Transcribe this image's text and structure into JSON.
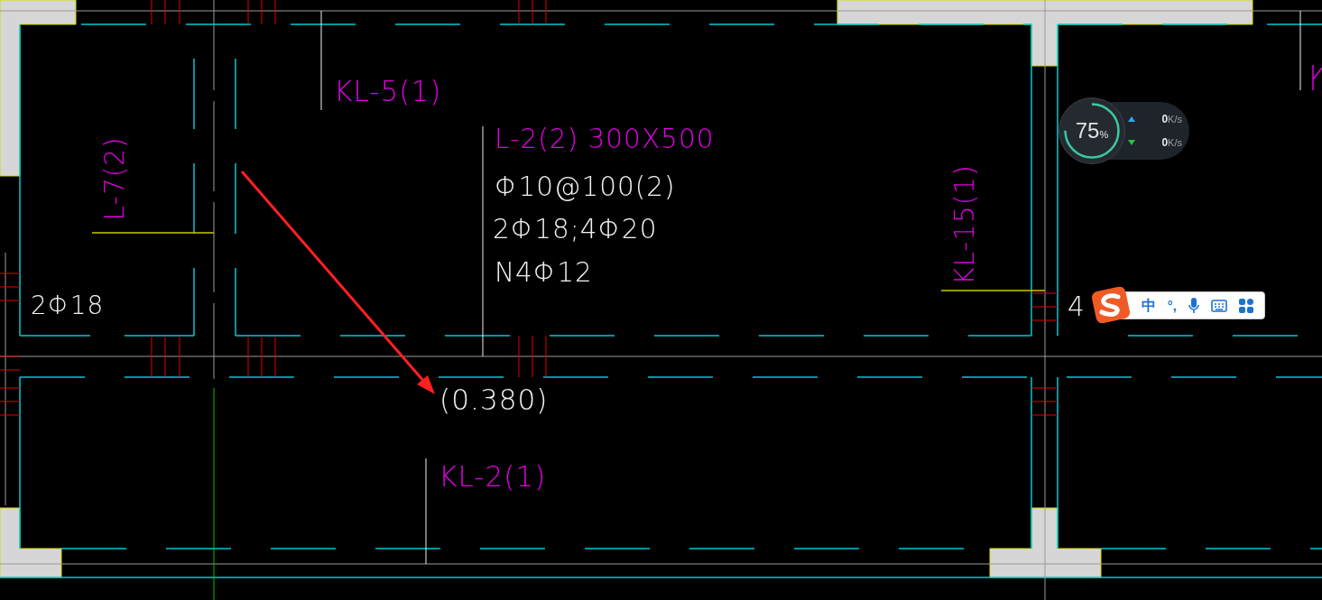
{
  "labels": [
    {
      "text": "KL-5(1)",
      "kind": "beam"
    },
    {
      "text": "L-2(2) 300X500",
      "kind": "beam"
    },
    {
      "text": "Φ10@100(2)",
      "kind": "rebar"
    },
    {
      "text": "2Φ18;4Φ20",
      "kind": "rebar"
    },
    {
      "text": "N4Φ12",
      "kind": "rebar"
    },
    {
      "text": "L-7(2)",
      "kind": "beam"
    },
    {
      "text": "KL-15(1)",
      "kind": "beam"
    },
    {
      "text": "2Φ18",
      "kind": "rebar"
    },
    {
      "text": "(0.380)",
      "kind": "rebar"
    },
    {
      "text": "KL-2(1)",
      "kind": "beam"
    },
    {
      "text": "4",
      "kind": "rebar"
    }
  ],
  "speed_widget": {
    "reading": "75",
    "unit": "%",
    "upload": "0",
    "upload_unit": "K/s",
    "download": "0",
    "download_unit": "K/s"
  },
  "ime_bar": {
    "mode": "中",
    "punctuation": "°,"
  }
}
